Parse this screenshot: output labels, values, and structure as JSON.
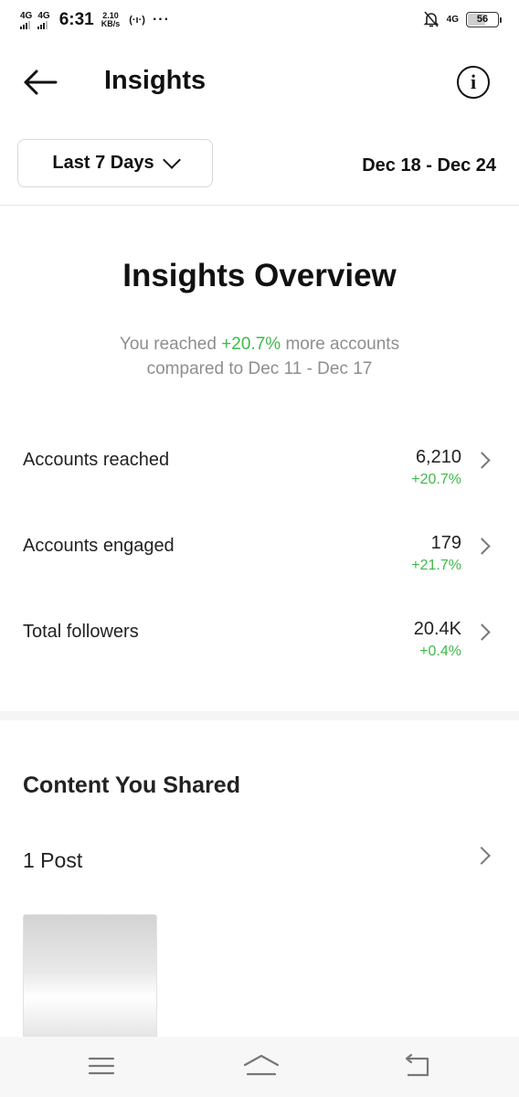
{
  "status_bar": {
    "network1": "4G",
    "network2": "4G",
    "time": "6:31",
    "speed_value": "2.10",
    "speed_unit": "KB/s",
    "network_right": "4G",
    "battery": "56"
  },
  "header": {
    "title": "Insights",
    "info_icon": "info-icon",
    "back_icon": "back-arrow-icon"
  },
  "filter": {
    "period_label": "Last 7 Days",
    "date_range": "Dec 18 - Dec 24"
  },
  "overview": {
    "title": "Insights Overview",
    "subtitle_prefix": "You reached ",
    "subtitle_change": "+20.7%",
    "subtitle_suffix": " more accounts",
    "subtitle_line2": "compared to Dec 11 - Dec 17",
    "metrics": [
      {
        "label": "Accounts reached",
        "value": "6,210",
        "change": "+20.7%"
      },
      {
        "label": "Accounts engaged",
        "value": "179",
        "change": "+21.7%"
      },
      {
        "label": "Total followers",
        "value": "20.4K",
        "change": "+0.4%"
      }
    ]
  },
  "content": {
    "title": "Content You Shared",
    "posts_label": "1 Post"
  },
  "colors": {
    "positive": "#3fb94a",
    "muted": "#8e8e8e"
  }
}
